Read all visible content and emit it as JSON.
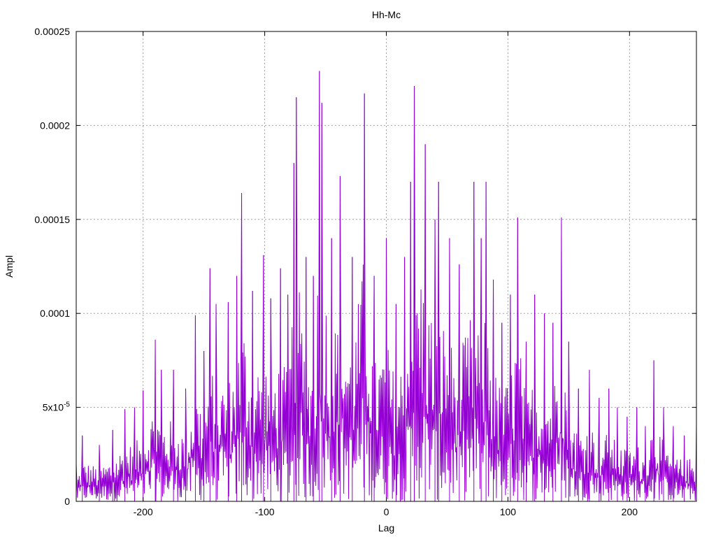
{
  "chart_data": {
    "type": "line",
    "title": "Hh-Mc",
    "xlabel": "Lag",
    "ylabel": "Ampl",
    "xlim": [
      -255,
      255
    ],
    "ylim": [
      0,
      0.00025
    ],
    "grid": true,
    "x_ticks": [
      {
        "value": -200,
        "label": "-200"
      },
      {
        "value": -100,
        "label": "-100"
      },
      {
        "value": 0,
        "label": "0"
      },
      {
        "value": 100,
        "label": "100"
      },
      {
        "value": 200,
        "label": "200"
      }
    ],
    "y_ticks": [
      {
        "value": 0,
        "label": "0"
      },
      {
        "value": 5e-05,
        "label": "5x10",
        "sup": "-5"
      },
      {
        "value": 0.0001,
        "label": "0.0001"
      },
      {
        "value": 0.00015,
        "label": "0.00015"
      },
      {
        "value": 0.0002,
        "label": "0.0002"
      },
      {
        "value": 0.00025,
        "label": "0.00025"
      }
    ],
    "series": [
      {
        "color": "#9400d3",
        "peaks": [
          {
            "x": -255,
            "y": 2e-05
          },
          {
            "x": -250,
            "y": 3.5e-05
          },
          {
            "x": -236,
            "y": 3e-05
          },
          {
            "x": -225,
            "y": 3.8e-05
          },
          {
            "x": -215,
            "y": 4.9e-05
          },
          {
            "x": -207,
            "y": 5e-05
          },
          {
            "x": -200,
            "y": 5.9e-05
          },
          {
            "x": -190,
            "y": 8.6e-05
          },
          {
            "x": -185,
            "y": 7e-05
          },
          {
            "x": -175,
            "y": 7e-05
          },
          {
            "x": -165,
            "y": 6e-05
          },
          {
            "x": -157,
            "y": 9.9e-05
          },
          {
            "x": -150,
            "y": 8e-05
          },
          {
            "x": -145,
            "y": 0.000124
          },
          {
            "x": -140,
            "y": 0.000105
          },
          {
            "x": -130,
            "y": 0.000106
          },
          {
            "x": -123,
            "y": 0.00012
          },
          {
            "x": -119,
            "y": 0.000164
          },
          {
            "x": -110,
            "y": 0.000112
          },
          {
            "x": -101,
            "y": 0.000131
          },
          {
            "x": -95,
            "y": 0.000108
          },
          {
            "x": -87,
            "y": 0.000124
          },
          {
            "x": -81,
            "y": 0.00011
          },
          {
            "x": -76,
            "y": 0.00018
          },
          {
            "x": -74,
            "y": 0.000215
          },
          {
            "x": -66,
            "y": 0.00013
          },
          {
            "x": -60,
            "y": 0.00012
          },
          {
            "x": -55,
            "y": 0.000229
          },
          {
            "x": -53,
            "y": 0.000212
          },
          {
            "x": -45,
            "y": 0.00014
          },
          {
            "x": -38,
            "y": 0.000173
          },
          {
            "x": -28,
            "y": 0.00013
          },
          {
            "x": -18,
            "y": 0.000217
          },
          {
            "x": -10,
            "y": 0.00012
          },
          {
            "x": 0,
            "y": 0.00014
          },
          {
            "x": 8,
            "y": 0.000105
          },
          {
            "x": 15,
            "y": 0.00013
          },
          {
            "x": 20,
            "y": 0.00017
          },
          {
            "x": 23,
            "y": 0.000221
          },
          {
            "x": 32,
            "y": 0.00019
          },
          {
            "x": 40,
            "y": 0.00015
          },
          {
            "x": 43,
            "y": 0.00017
          },
          {
            "x": 52,
            "y": 0.00014
          },
          {
            "x": 60,
            "y": 0.000126
          },
          {
            "x": 72,
            "y": 0.00017
          },
          {
            "x": 78,
            "y": 0.00014
          },
          {
            "x": 82,
            "y": 0.00017
          },
          {
            "x": 88,
            "y": 0.000118
          },
          {
            "x": 95,
            "y": 9.5e-05
          },
          {
            "x": 102,
            "y": 0.00011
          },
          {
            "x": 108,
            "y": 0.000151
          },
          {
            "x": 115,
            "y": 8.5e-05
          },
          {
            "x": 122,
            "y": 0.00011
          },
          {
            "x": 130,
            "y": 0.0001
          },
          {
            "x": 137,
            "y": 9.5e-05
          },
          {
            "x": 144,
            "y": 0.000151
          },
          {
            "x": 150,
            "y": 8.5e-05
          },
          {
            "x": 158,
            "y": 6e-05
          },
          {
            "x": 167,
            "y": 7e-05
          },
          {
            "x": 175,
            "y": 5.5e-05
          },
          {
            "x": 183,
            "y": 6e-05
          },
          {
            "x": 190,
            "y": 5e-05
          },
          {
            "x": 198,
            "y": 4.5e-05
          },
          {
            "x": 206,
            "y": 5e-05
          },
          {
            "x": 213,
            "y": 4e-05
          },
          {
            "x": 220,
            "y": 7.5e-05
          },
          {
            "x": 228,
            "y": 5e-05
          },
          {
            "x": 236,
            "y": 4e-05
          },
          {
            "x": 245,
            "y": 3.5e-05
          },
          {
            "x": 255,
            "y": 4.1e-05
          }
        ]
      }
    ]
  }
}
